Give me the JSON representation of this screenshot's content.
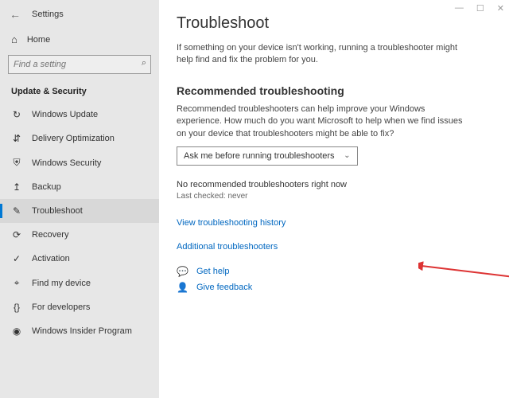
{
  "app": {
    "title": "Settings"
  },
  "sidebar": {
    "home": "Home",
    "search_placeholder": "Find a setting",
    "section": "Update & Security",
    "items": [
      {
        "icon": "↻",
        "label": "Windows Update"
      },
      {
        "icon": "⇵",
        "label": "Delivery Optimization"
      },
      {
        "icon": "⛨",
        "label": "Windows Security"
      },
      {
        "icon": "↥",
        "label": "Backup"
      },
      {
        "icon": "✎",
        "label": "Troubleshoot"
      },
      {
        "icon": "⟳",
        "label": "Recovery"
      },
      {
        "icon": "✓",
        "label": "Activation"
      },
      {
        "icon": "⌖",
        "label": "Find my device"
      },
      {
        "icon": "{}",
        "label": "For developers"
      },
      {
        "icon": "◉",
        "label": "Windows Insider Program"
      }
    ]
  },
  "main": {
    "title": "Troubleshoot",
    "desc": "If something on your device isn't working, running a troubleshooter might help find and fix the problem for you.",
    "rec_title": "Recommended troubleshooting",
    "rec_desc": "Recommended troubleshooters can help improve your Windows experience. How much do you want Microsoft to help when we find issues on your device that troubleshooters might be able to fix?",
    "dropdown": "Ask me before running troubleshooters",
    "status": "No recommended troubleshooters right now",
    "last_checked": "Last checked: never",
    "history_link": "View troubleshooting history",
    "additional_link": "Additional troubleshooters",
    "get_help": "Get help",
    "give_feedback": "Give feedback"
  }
}
